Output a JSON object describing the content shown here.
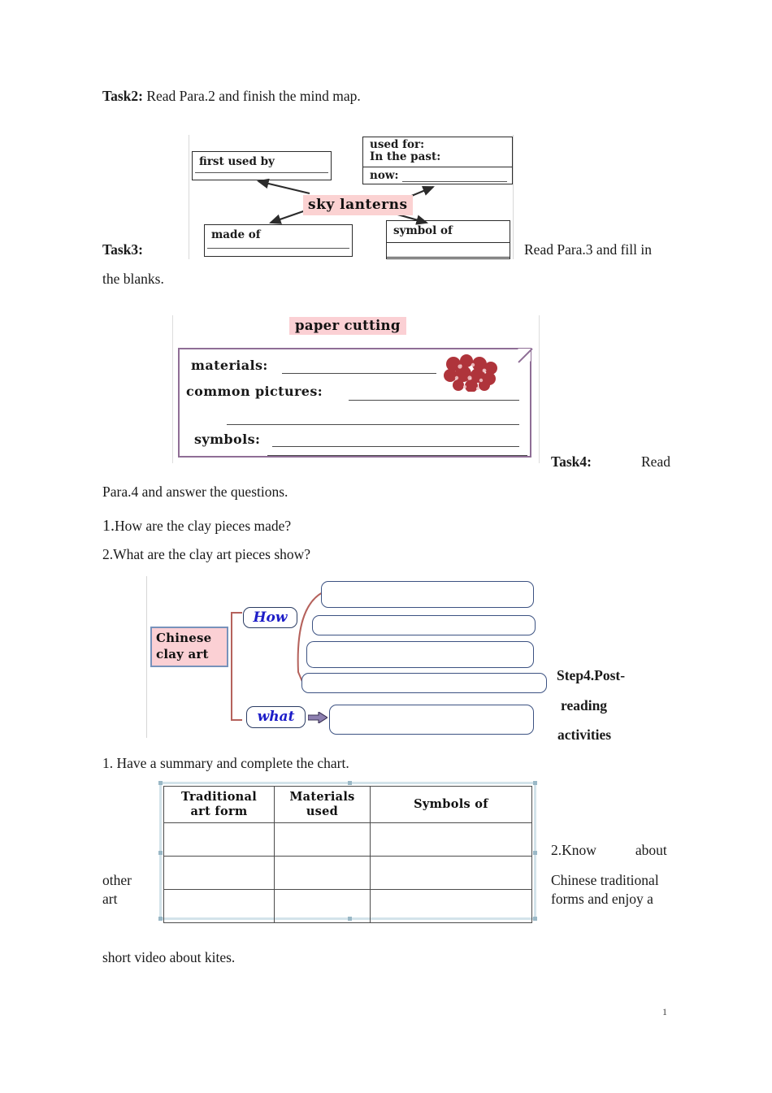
{
  "document": {
    "page_number": "1"
  },
  "task2": {
    "label": "Task2:",
    "instruction": " Read Para.2 and finish the mind map."
  },
  "sky_lantern_map": {
    "center_label": "sky lanterns",
    "boxes": {
      "first_used_by": "first used by",
      "used_for": "used for:",
      "in_the_past": "In the past:",
      "now": "now:",
      "made_of": "made of",
      "symbol_of": "symbol of"
    }
  },
  "task3": {
    "label": "Task3:",
    "instruction_right": "Read Para.3 and fill  in",
    "instruction_cont": "the blanks."
  },
  "paper_cutting": {
    "title": "paper cutting",
    "materials": "materials:",
    "common_pictures": "common pictures:",
    "symbols": "symbols:"
  },
  "task4": {
    "label": "Task4:",
    "read": "Read",
    "instruction_cont": "Para.4 and answer the questions.",
    "questions": [
      {
        "number": "1.",
        "text": "How are the clay pieces made?"
      },
      {
        "number": "2.",
        "text": "What are the clay art pieces show?"
      }
    ]
  },
  "clay_art_map": {
    "center_label_line1": "Chinese",
    "center_label_line2": "clay art",
    "branch_how": "How",
    "branch_what": "what"
  },
  "step4": {
    "line1": "Step4.Post-",
    "line2": "reading",
    "line3": "activities"
  },
  "post_reading": {
    "item1": "1.   Have a summary and complete the chart.",
    "item2_seg1": "2.Know",
    "item2_seg2": "about",
    "item2_seg3": "Chinese  traditional",
    "item2_seg4": "other",
    "item2_seg5": "art",
    "item2_seg6": "forms  and  enjoy a",
    "item2_seg7": "short video about kites."
  },
  "summary_table": {
    "headers": [
      "Traditional\nart form",
      "Materials\nused",
      "Symbols of"
    ],
    "header_lines": [
      [
        "Traditional",
        "art form"
      ],
      [
        "Materials",
        "used"
      ],
      [
        "Symbols of",
        ""
      ]
    ],
    "rows": [
      [
        "",
        "",
        ""
      ],
      [
        "",
        "",
        ""
      ],
      [
        "",
        "",
        ""
      ]
    ]
  },
  "colors": {
    "pink_highlight": "#fbd0d4",
    "purple_border": "#8f6e96",
    "blue_box_border": "#3c5282",
    "blue_text": "#1d1dc8",
    "bracket_red": "#b5625c",
    "table_handle": "#9ab8c6"
  }
}
